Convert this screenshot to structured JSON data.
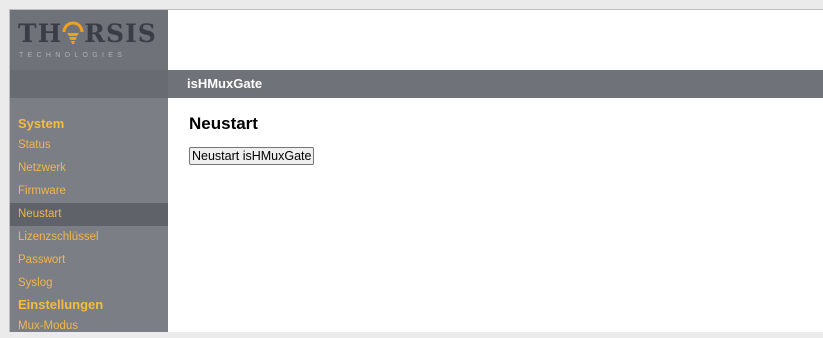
{
  "logo": {
    "word_left": "TH",
    "word_right": "RSIS",
    "sub": "TECHNOLOGIES"
  },
  "header": {
    "title": "isHMuxGate"
  },
  "sidebar": {
    "groups": [
      {
        "label": "System",
        "items": [
          "Status",
          "Netzwerk",
          "Firmware",
          "Neustart",
          "Lizenzschlüssel",
          "Passwort",
          "Syslog"
        ]
      },
      {
        "label": "Einstellungen",
        "items": [
          "Mux-Modus"
        ]
      }
    ],
    "active": "Neustart"
  },
  "main": {
    "title": "Neustart",
    "restart_button": "Neustart isHMuxGate"
  },
  "colors": {
    "accent": "#f6bb3f",
    "sidebar": "#7b7e84",
    "header": "#6f7278"
  }
}
